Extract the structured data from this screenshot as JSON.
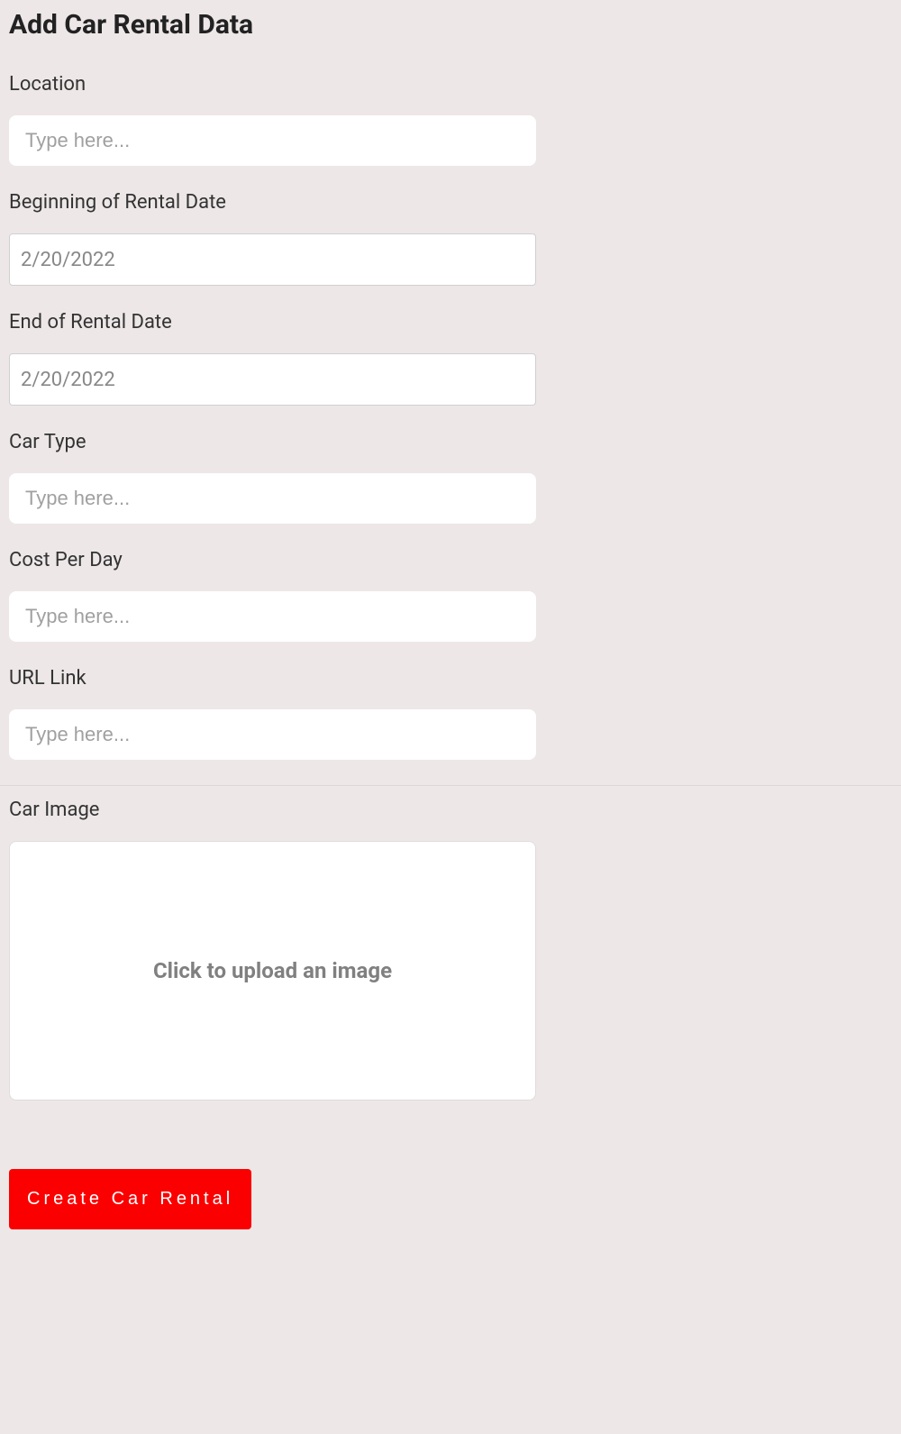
{
  "page": {
    "title": "Add Car Rental Data"
  },
  "form": {
    "location": {
      "label": "Location",
      "placeholder": "Type here..."
    },
    "startDate": {
      "label": "Beginning of Rental Date",
      "value": "2/20/2022"
    },
    "endDate": {
      "label": "End of Rental Date",
      "value": "2/20/2022"
    },
    "carType": {
      "label": "Car Type",
      "placeholder": "Type here..."
    },
    "costPerDay": {
      "label": "Cost Per Day",
      "placeholder": "Type here..."
    },
    "urlLink": {
      "label": "URL Link",
      "placeholder": "Type here..."
    },
    "carImage": {
      "label": "Car Image",
      "uploadText": "Click to upload an image"
    },
    "submitLabel": "Create Car Rental"
  }
}
